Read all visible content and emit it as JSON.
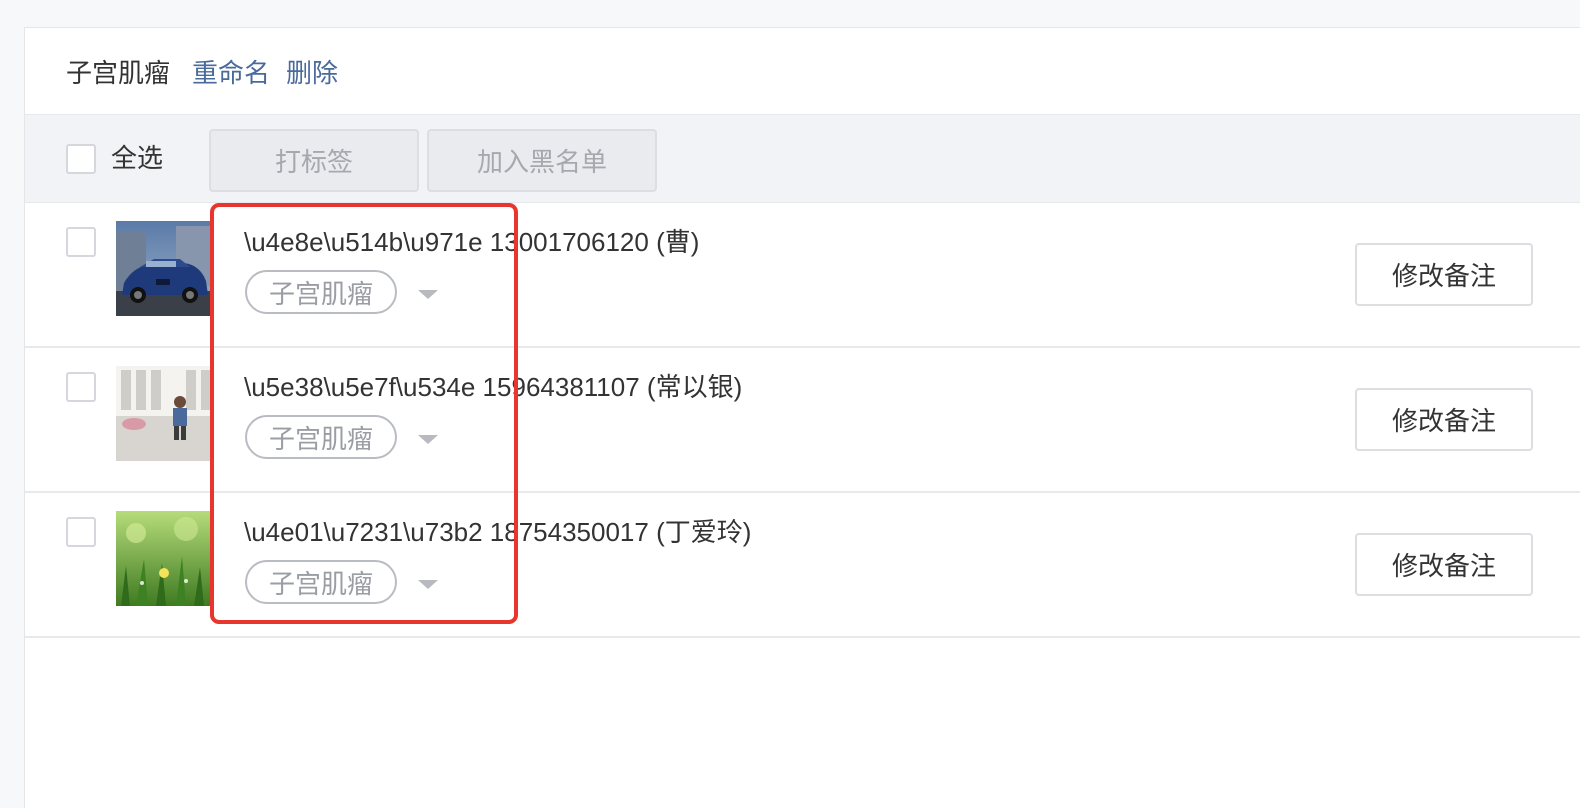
{
  "group": {
    "title": "子宫肌瘤",
    "rename_label": "重命名",
    "delete_label": "删除"
  },
  "toolbar": {
    "select_all_label": "全选",
    "tag_button_label": "打标签",
    "blacklist_button_label": "加入黑名单"
  },
  "rows": [
    {
      "name": "\\u4e8e\\u514b\\u971e 13001706120 (曹)",
      "tag": "子宫肌瘤",
      "remark_button": "修改备注",
      "avatar": "car-photo"
    },
    {
      "name": "\\u5e38\\u5e7f\\u534e 15964381107 (常以银)",
      "tag": "子宫肌瘤",
      "remark_button": "修改备注",
      "avatar": "child-photo"
    },
    {
      "name": "\\u4e01\\u7231\\u73b2 18754350017 (丁爱玲)",
      "tag": "子宫肌瘤",
      "remark_button": "修改备注",
      "avatar": "grass-photo"
    }
  ],
  "colors": {
    "link": "#4a6a9c",
    "highlight": "#e8352d",
    "toolbar_bg": "#f2f3f7"
  }
}
